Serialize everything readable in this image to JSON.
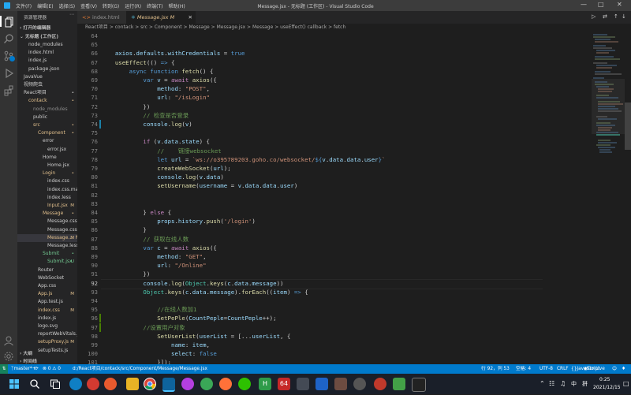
{
  "titlebar": {
    "menus": [
      "文件(F)",
      "编辑(E)",
      "选择(S)",
      "查看(V)",
      "转到(G)",
      "运行(R)",
      "终端(T)",
      "帮助(H)"
    ],
    "window_title": "Message.jsx - 无标题 (工作区) - Visual Studio Code"
  },
  "sidebar": {
    "header": "资源管理器",
    "open_editors": "打开的编辑器",
    "workspace": "无标题 (工作区)",
    "rows": [
      {
        "label": "node_modules",
        "indent": 14,
        "mark": "",
        "color": "#cccccc"
      },
      {
        "label": "index.html",
        "indent": 14,
        "mark": "",
        "color": "#cccccc"
      },
      {
        "label": "index.js",
        "indent": 14,
        "mark": "",
        "color": "#cccccc"
      },
      {
        "label": "package.json",
        "indent": 14,
        "mark": "",
        "color": "#cccccc"
      },
      {
        "label": "JavaVue",
        "indent": 8,
        "mark": "",
        "color": "#cccccc"
      },
      {
        "label": "视频爬虫",
        "indent": 8,
        "mark": "",
        "color": "#cccccc"
      },
      {
        "label": "React项目",
        "indent": 8,
        "mark": "•",
        "color": "#cccccc"
      },
      {
        "label": "contack",
        "indent": 14,
        "mark": "•",
        "color": "#e2c08d"
      },
      {
        "label": "node_modules",
        "indent": 20,
        "mark": "",
        "color": "#8c8c8c"
      },
      {
        "label": "public",
        "indent": 20,
        "mark": "",
        "color": "#cccccc"
      },
      {
        "label": "src",
        "indent": 20,
        "mark": "•",
        "color": "#e2c08d"
      },
      {
        "label": "Component",
        "indent": 26,
        "mark": "•",
        "color": "#e2c08d"
      },
      {
        "label": "error",
        "indent": 32,
        "mark": "",
        "color": "#cccccc"
      },
      {
        "label": "error.jsx",
        "indent": 38,
        "mark": "",
        "color": "#cccccc"
      },
      {
        "label": "Home",
        "indent": 32,
        "mark": "",
        "color": "#cccccc"
      },
      {
        "label": "Home.jsx",
        "indent": 38,
        "mark": "",
        "color": "#cccccc"
      },
      {
        "label": "Login",
        "indent": 32,
        "mark": "•",
        "color": "#e2c08d"
      },
      {
        "label": "index.css",
        "indent": 38,
        "mark": "",
        "color": "#cccccc"
      },
      {
        "label": "index.css.map",
        "indent": 38,
        "mark": "",
        "color": "#cccccc"
      },
      {
        "label": "index.less",
        "indent": 38,
        "mark": "",
        "color": "#cccccc"
      },
      {
        "label": "Input.jsx",
        "indent": 38,
        "mark": "M",
        "color": "#e2c08d"
      },
      {
        "label": "Message",
        "indent": 32,
        "mark": "•",
        "color": "#e2c08d"
      },
      {
        "label": "Message.css",
        "indent": 38,
        "mark": "",
        "color": "#cccccc"
      },
      {
        "label": "Message.css.m...",
        "indent": 38,
        "mark": "",
        "color": "#cccccc"
      },
      {
        "label": "Message.... M",
        "indent": 38,
        "mark": "M",
        "color": "#e2c08d"
      },
      {
        "label": "Message.less",
        "indent": 38,
        "mark": "",
        "color": "#cccccc"
      },
      {
        "label": "Submit",
        "indent": 32,
        "mark": "•",
        "color": "#73c991"
      },
      {
        "label": "Submit.jsx",
        "indent": 38,
        "mark": "U",
        "color": "#73c991"
      },
      {
        "label": "Router",
        "indent": 26,
        "mark": "",
        "color": "#cccccc"
      },
      {
        "label": "WebSocket",
        "indent": 26,
        "mark": "",
        "color": "#cccccc"
      },
      {
        "label": "App.css",
        "indent": 26,
        "mark": "",
        "color": "#cccccc"
      },
      {
        "label": "App.js",
        "indent": 26,
        "mark": "M",
        "color": "#e2c08d"
      },
      {
        "label": "App.test.js",
        "indent": 26,
        "mark": "",
        "color": "#cccccc"
      },
      {
        "label": "index.css",
        "indent": 26,
        "mark": "M",
        "color": "#e2c08d"
      },
      {
        "label": "index.js",
        "indent": 26,
        "mark": "",
        "color": "#cccccc"
      },
      {
        "label": "logo.svg",
        "indent": 26,
        "mark": "",
        "color": "#cccccc"
      },
      {
        "label": "reportWebVitals.js",
        "indent": 26,
        "mark": "",
        "color": "#cccccc"
      },
      {
        "label": "setupProxy.js",
        "indent": 26,
        "mark": "M",
        "color": "#e2c08d"
      },
      {
        "label": "setupTests.js",
        "indent": 26,
        "mark": "",
        "color": "#cccccc"
      }
    ],
    "outline": "大纲",
    "timeline": "时间线"
  },
  "tabs": [
    {
      "label": "index.html",
      "active": false
    },
    {
      "label": "Message.jsx M",
      "active": true
    }
  ],
  "breadcrumb": "React项目 > contack > src > Component > Message > Message.jsx > Message > useEffect() callback > fetch",
  "code_lines": [
    {
      "n": "64",
      "html": ""
    },
    {
      "n": "65",
      "html": ""
    },
    {
      "n": "66",
      "html": "    <span class='vr'>axios</span><span class='pl'>.</span><span class='vr'>defaults</span><span class='pl'>.</span><span class='vr'>withCredentials</span><span class='pl'> = </span><span class='kw'>true</span>"
    },
    {
      "n": "67",
      "html": "    <span class='fn'>useEffect</span><span class='pl'>(() </span><span class='kw'>=&gt;</span><span class='pl'> {</span>"
    },
    {
      "n": "68",
      "html": "        <span class='kw'>async function</span><span class='pl'> </span><span class='fn'>fetch</span><span class='pl'>() {</span>"
    },
    {
      "n": "69",
      "html": "            <span class='kw'>var</span><span class='pl'> </span><span class='vr'>v</span><span class='pl'> = </span><span class='cf'>await</span><span class='pl'> </span><span class='fn'>axios</span><span class='pl'>({</span>"
    },
    {
      "n": "70",
      "html": "                <span class='vr'>method</span><span class='pl'>: </span><span class='st'>\"POST\"</span><span class='pl'>,</span>"
    },
    {
      "n": "71",
      "html": "                <span class='vr'>url</span><span class='pl'>: </span><span class='st'>\"/isLogin\"</span>"
    },
    {
      "n": "72",
      "html": "            <span class='pl'>})</span>"
    },
    {
      "n": "73",
      "html": "            <span class='cm'>// 检查是否登录</span>"
    },
    {
      "n": "74",
      "html": "            <span class='vr'>console</span><span class='pl'>.</span><span class='fn'>log</span><span class='pl'>(</span><span class='vr'>v</span><span class='pl'>)</span>"
    },
    {
      "n": "75",
      "html": ""
    },
    {
      "n": "76",
      "html": "            <span class='cf'>if</span><span class='pl'> (</span><span class='vr'>v</span><span class='pl'>.</span><span class='vr'>data</span><span class='pl'>.</span><span class='vr'>state</span><span class='pl'>) {</span>"
    },
    {
      "n": "77",
      "html": "                <span class='cm'>//    链接websocket</span>"
    },
    {
      "n": "78",
      "html": "                <span class='kw'>let</span><span class='pl'> </span><span class='vr'>url</span><span class='pl'> = </span><span class='st'>`ws://o395789203.goho.co/websocket/</span><span class='kw'>${</span><span class='vr'>v</span><span class='pl'>.</span><span class='vr'>data</span><span class='pl'>.</span><span class='vr'>data</span><span class='pl'>.</span><span class='vr'>user</span><span class='kw'>}</span><span class='st'>`</span>"
    },
    {
      "n": "79",
      "html": "                <span class='fn'>createWebSocket</span><span class='pl'>(</span><span class='vr'>url</span><span class='pl'>);</span>"
    },
    {
      "n": "80",
      "html": "                <span class='vr'>console</span><span class='pl'>.</span><span class='fn'>log</span><span class='pl'>(</span><span class='vr'>v</span><span class='pl'>.</span><span class='vr'>data</span><span class='pl'>)</span>"
    },
    {
      "n": "81",
      "html": "                <span class='fn'>setUsername</span><span class='pl'>(</span><span class='vr'>username</span><span class='pl'> = </span><span class='vr'>v</span><span class='pl'>.</span><span class='vr'>data</span><span class='pl'>.</span><span class='vr'>data</span><span class='pl'>.</span><span class='vr'>user</span><span class='pl'>)</span>"
    },
    {
      "n": "82",
      "html": ""
    },
    {
      "n": "83",
      "html": ""
    },
    {
      "n": "84",
      "html": "            <span class='pl'>} </span><span class='cf'>else</span><span class='pl'> {</span>"
    },
    {
      "n": "85",
      "html": "                <span class='vr'>props</span><span class='pl'>.</span><span class='vr'>history</span><span class='pl'>.</span><span class='fn'>push</span><span class='pl'>(</span><span class='st'>'/login'</span><span class='pl'>)</span>"
    },
    {
      "n": "86",
      "html": "            <span class='pl'>}</span>"
    },
    {
      "n": "87",
      "html": "            <span class='cm'>// 获取在线人数</span>"
    },
    {
      "n": "88",
      "html": "            <span class='kw'>var</span><span class='pl'> </span><span class='vr'>c</span><span class='pl'> = </span><span class='cf'>await</span><span class='pl'> </span><span class='fn'>axios</span><span class='pl'>({</span>"
    },
    {
      "n": "89",
      "html": "                <span class='vr'>method</span><span class='pl'>: </span><span class='st'>\"GET\"</span><span class='pl'>,</span>"
    },
    {
      "n": "90",
      "html": "                <span class='vr'>url</span><span class='pl'>: </span><span class='st'>\"/Online\"</span>"
    },
    {
      "n": "91",
      "html": "            <span class='pl'>})</span>"
    },
    {
      "n": "92",
      "html": "            <span class='vr'>console</span><span class='pl'>.</span><span class='fn'>log</span><span class='pl'>(</span><span class='ty'>Object</span><span class='pl'>.</span><span class='fn'>keys</span><span class='pl'>(</span><span class='vr'>c</span><span class='pl'>.</span><span class='vr'>data</span><span class='pl'>.</span><span class='vr'>message</span><span class='pl'>))</span>"
    },
    {
      "n": "93",
      "html": "            <span class='ty'>Object</span><span class='pl'>.</span><span class='fn'>keys</span><span class='pl'>(</span><span class='vr'>c</span><span class='pl'>.</span><span class='vr'>data</span><span class='pl'>.</span><span class='vr'>message</span><span class='pl'>).</span><span class='fn'>forEach</span><span class='pl'>((</span><span class='vr'>item</span><span class='pl'>) </span><span class='kw'>=&gt;</span><span class='pl'> {</span>"
    },
    {
      "n": "94",
      "html": ""
    },
    {
      "n": "95",
      "html": "                <span class='cm'>//在线人数加1</span>"
    },
    {
      "n": "96",
      "html": "                <span class='fn'>SetPePle</span><span class='pl'>(</span><span class='vr'>CountPeple</span><span class='pl'>=</span><span class='vr'>CountPeple</span><span class='pl'>++);</span>"
    },
    {
      "n": "97",
      "html": "            <span class='cm'>//设置用户对象</span>"
    },
    {
      "n": "98",
      "html": "                <span class='fn'>SetUserList</span><span class='pl'>(</span><span class='vr'>userList</span><span class='pl'> = [...</span><span class='vr'>userList</span><span class='pl'>, {</span>"
    },
    {
      "n": "99",
      "html": "                    <span class='vr'>name</span><span class='pl'>: </span><span class='vr'>item</span><span class='pl'>,</span>"
    },
    {
      "n": "100",
      "html": "                    <span class='vr'>select</span><span class='pl'>: </span><span class='kw'>false</span>"
    },
    {
      "n": "101",
      "html": "                <span class='pl'>}]);</span>"
    }
  ],
  "status": {
    "branch": "master*+",
    "errors": "⊗ 0 ⚠ 0",
    "path": "d:/React项目/contack/src/Component/Message/Message.jsx",
    "position": "行 92，列 53",
    "spaces": "空格: 4",
    "encoding": "UTF-8",
    "eol": "CRLF",
    "language": "JavaScript",
    "golive": "Go Live"
  },
  "taskbar": {
    "ime1": "中",
    "ime2": "拼",
    "time": "0:25",
    "date": "2021/12/15"
  },
  "colors": {
    "accent": "#007acc",
    "editor_bg": "#1e1e1e",
    "sidebar_bg": "#252526",
    "activity_bg": "#333333"
  }
}
